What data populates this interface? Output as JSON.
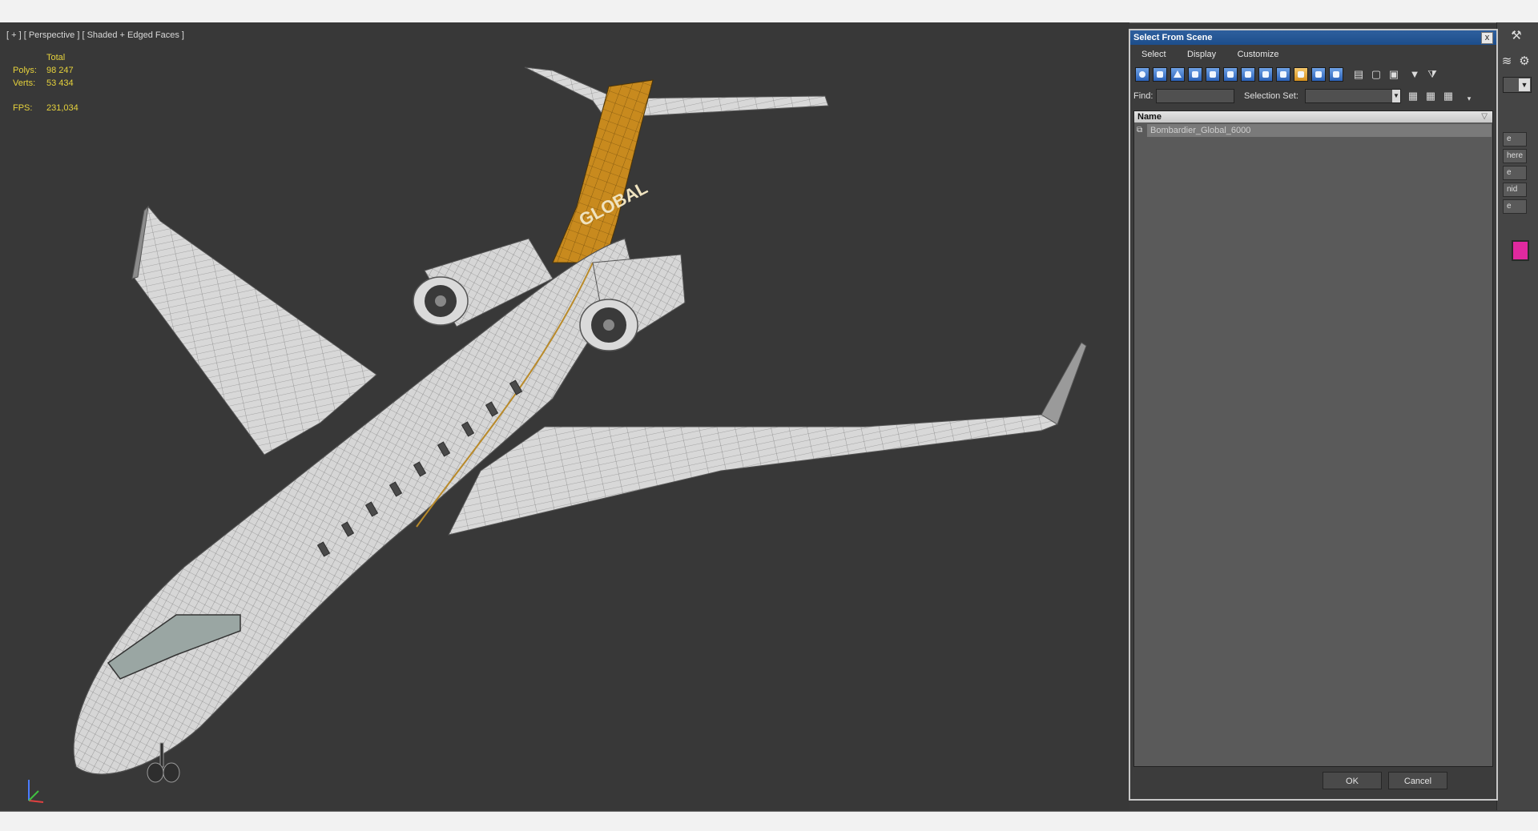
{
  "viewport": {
    "label": "[ + ] [ Perspective ] [ Shaded + Edged Faces ]",
    "stats": {
      "total_label": "Total",
      "polys_label": "Polys:",
      "polys_value": "98 247",
      "verts_label": "Verts:",
      "verts_value": "53 434",
      "fps_label": "FPS:",
      "fps_value": "231,034"
    },
    "livery_text": "GLOBAL"
  },
  "dialog": {
    "title": "Select From Scene",
    "close": "x",
    "menu": [
      "Select",
      "Display",
      "Customize"
    ],
    "find_label": "Find:",
    "find_value": "",
    "selection_set_label": "Selection Set:",
    "selection_set_value": "",
    "list_header": "Name",
    "rows": [
      {
        "name": "Bombardier_Global_6000",
        "selected": true
      }
    ],
    "ok_label": "OK",
    "cancel_label": "Cancel"
  },
  "command_panel": {
    "buttons": [
      "e",
      "here",
      "e",
      "nid",
      "e"
    ],
    "swatch_color": "#e0299f"
  },
  "colors": {
    "viewport_bg": "#383838",
    "stats_text": "#e6d23c",
    "accent_orange": "#c8891c",
    "title_blue": "#1d4e8c"
  }
}
